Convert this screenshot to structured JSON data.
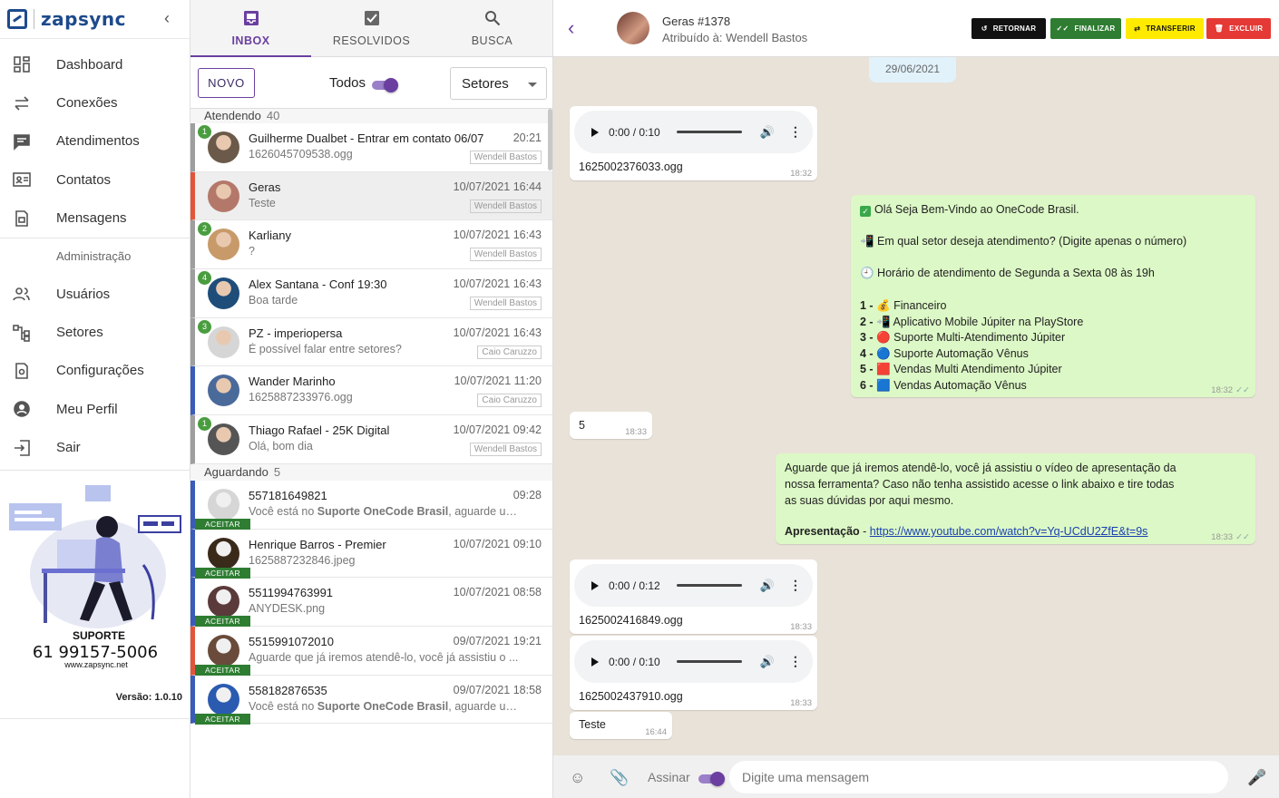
{
  "brand": {
    "name": "zapsync",
    "collapse_icon": "chevron-left-icon"
  },
  "nav": {
    "items": [
      {
        "label": "Dashboard",
        "icon": "dashboard-icon"
      },
      {
        "label": "Conexões",
        "icon": "swap-arrows-icon"
      },
      {
        "label": "Atendimentos",
        "icon": "chat-icon"
      },
      {
        "label": "Contatos",
        "icon": "contact-card-icon"
      },
      {
        "label": "Mensagens",
        "icon": "message-file-icon"
      }
    ],
    "admin_title": "Administração",
    "admin_items": [
      {
        "label": "Usuários",
        "icon": "users-icon"
      },
      {
        "label": "Setores",
        "icon": "sector-tree-icon"
      },
      {
        "label": "Configurações",
        "icon": "settings-file-icon"
      },
      {
        "label": "Meu Perfil",
        "icon": "profile-icon"
      },
      {
        "label": "Sair",
        "icon": "logout-icon"
      }
    ]
  },
  "support": {
    "label": "SUPORTE",
    "phone": "61 99157-5006",
    "site": "www.zapsync.net",
    "version": "Versão: 1.0.10"
  },
  "tabs": [
    {
      "label": "INBOX",
      "icon": "inbox-icon",
      "active": true
    },
    {
      "label": "RESOLVIDOS",
      "icon": "check-box-icon",
      "active": false
    },
    {
      "label": "BUSCA",
      "icon": "search-icon",
      "active": false
    }
  ],
  "toolbar": {
    "new_label": "NOVO",
    "toggle_label": "Todos",
    "toggle_on": true,
    "sector_select": "Setores"
  },
  "groups": {
    "attending": {
      "label": "Atendendo",
      "count": "40"
    },
    "waiting": {
      "label": "Aguardando",
      "count": "5"
    }
  },
  "attending": [
    {
      "name": "Guilherme Dualbet - Entrar em contato 06/07",
      "time": "20:21",
      "last": "1626045709538.ogg",
      "user": "Wendell Bastos",
      "badge": "1",
      "color": "#9e9e9e",
      "av": "#6b5a4a"
    },
    {
      "name": "Geras",
      "time": "10/07/2021 16:44",
      "last": "Teste",
      "user": "Wendell Bastos",
      "badge": "",
      "color": "#e2553a",
      "av": "#b4786a",
      "selected": true
    },
    {
      "name": "Karliany",
      "time": "10/07/2021 16:43",
      "last": "?",
      "user": "Wendell Bastos",
      "badge": "2",
      "color": "#9e9e9e",
      "av": "#c89a6a"
    },
    {
      "name": "Alex Santana - Conf 19:30",
      "time": "10/07/2021 16:43",
      "last": "Boa tarde",
      "user": "Wendell Bastos",
      "badge": "4",
      "color": "#9e9e9e",
      "av": "#1e4d7a"
    },
    {
      "name": "PZ - imperiopersa",
      "time": "10/07/2021 16:43",
      "last": "É possível falar entre setores?",
      "user": "Caio Caruzzo",
      "badge": "3",
      "color": "#9e9e9e",
      "av": "#d6d6d6"
    },
    {
      "name": "Wander Marinho",
      "time": "10/07/2021 11:20",
      "last": "1625887233976.ogg",
      "user": "Caio Caruzzo",
      "badge": "",
      "color": "#3a5bb8",
      "av": "#4a6a9a"
    },
    {
      "name": "Thiago Rafael - 25K Digital",
      "time": "10/07/2021 09:42",
      "last": "Olá, bom dia",
      "user": "Wendell Bastos",
      "badge": "1",
      "color": "#9e9e9e",
      "av": "#555555"
    }
  ],
  "waiting": [
    {
      "name": "557181649821",
      "time": "09:28",
      "last_pre": "Você está no ",
      "last_bold": "Suporte OneCode Brasil",
      "last_post": ", aguarde um ...",
      "color": "#3a5bb8",
      "av": "#d6d6d6",
      "accept": "ACEITAR"
    },
    {
      "name": "Henrique Barros - Premier",
      "time": "10/07/2021 09:10",
      "last_pre": "1625887232846.jpeg",
      "last_bold": "",
      "last_post": "",
      "color": "#3a5bb8",
      "av": "#3a2a1a",
      "accept": "ACEITAR"
    },
    {
      "name": "5511994763991",
      "time": "10/07/2021 08:58",
      "last_pre": "ANYDESK.png",
      "last_bold": "",
      "last_post": "",
      "color": "#3a5bb8",
      "av": "#5a3a3a",
      "accept": "ACEITAR"
    },
    {
      "name": "5515991072010",
      "time": "09/07/2021 19:21",
      "last_pre": "Aguarde que já iremos atendê-lo, você já assistiu o ...",
      "last_bold": "",
      "last_post": "",
      "color": "#e2553a",
      "av": "#6a4a3a",
      "accept": "ACEITAR"
    },
    {
      "name": "558182876535",
      "time": "09/07/2021 18:58",
      "last_pre": "Você está no ",
      "last_bold": "Suporte OneCode Brasil",
      "last_post": ", aguarde um ...",
      "color": "#3a5bb8",
      "av": "#2a5bb0",
      "accept": "ACEITAR"
    }
  ],
  "chat": {
    "title": "Geras #1378",
    "subtitle": "Atribuído à: Wendell Bastos",
    "buttons": [
      {
        "label": "RETORNAR",
        "icon": "undo-icon"
      },
      {
        "label": "FINALIZAR",
        "icon": "double-check-icon"
      },
      {
        "label": "TRANSFERIR",
        "icon": "transfer-icon"
      },
      {
        "label": "EXCLUIR",
        "icon": "trash-icon"
      }
    ],
    "date": "29/06/2021",
    "audio1": {
      "time": "0:00 / 0:10",
      "file": "1625002376033.ogg",
      "stamp": "18:32"
    },
    "menu": {
      "greeting": "Olá Seja Bem-Vindo ao OneCode Brasil.",
      "question": "Em qual setor deseja atendimento? (Digite apenas o número)",
      "hours": "Horário de atendimento de Segunda a Sexta 08 às 19h",
      "options": [
        {
          "n": "1 -",
          "emoji": "💰",
          "text": "Financeiro"
        },
        {
          "n": "2 -",
          "emoji": "📲",
          "text": "Aplicativo Mobile Júpiter na PlayStore"
        },
        {
          "n": "3 -",
          "emoji": "🔴",
          "text": "Suporte Multi-Atendimento Júpiter"
        },
        {
          "n": "4 -",
          "emoji": "🔵",
          "text": "Suporte Automação Vênus"
        },
        {
          "n": "5 -",
          "emoji": "🟥",
          "text": "Vendas Multi Atendimento Júpiter"
        },
        {
          "n": "6 -",
          "emoji": "🟦",
          "text": "Vendas Automação Vênus"
        }
      ],
      "stamp": "18:32"
    },
    "reply": {
      "text": "5",
      "stamp": "18:33"
    },
    "wait_msg": {
      "line1": "Aguarde que já iremos atendê-lo, você já assistiu o vídeo de apresentação da",
      "line2": "nossa ferramenta? Caso não tenha assistido acesse o link abaixo e tire todas",
      "line3": "as suas dúvidas por aqui mesmo.",
      "link_label": "Apresentação",
      "link_url": "https://www.youtube.com/watch?v=Yq-UCdU2ZfE&t=9s",
      "stamp": "18:33"
    },
    "audio2": {
      "time": "0:00 / 0:12",
      "file": "1625002416849.ogg",
      "stamp": "18:33"
    },
    "audio3": {
      "time": "0:00 / 0:10",
      "file": "1625002437910.ogg",
      "stamp": "18:33"
    },
    "teste": {
      "text": "Teste",
      "stamp": "16:44"
    },
    "footer": {
      "sign_label": "Assinar",
      "placeholder": "Digite uma mensagem"
    }
  }
}
